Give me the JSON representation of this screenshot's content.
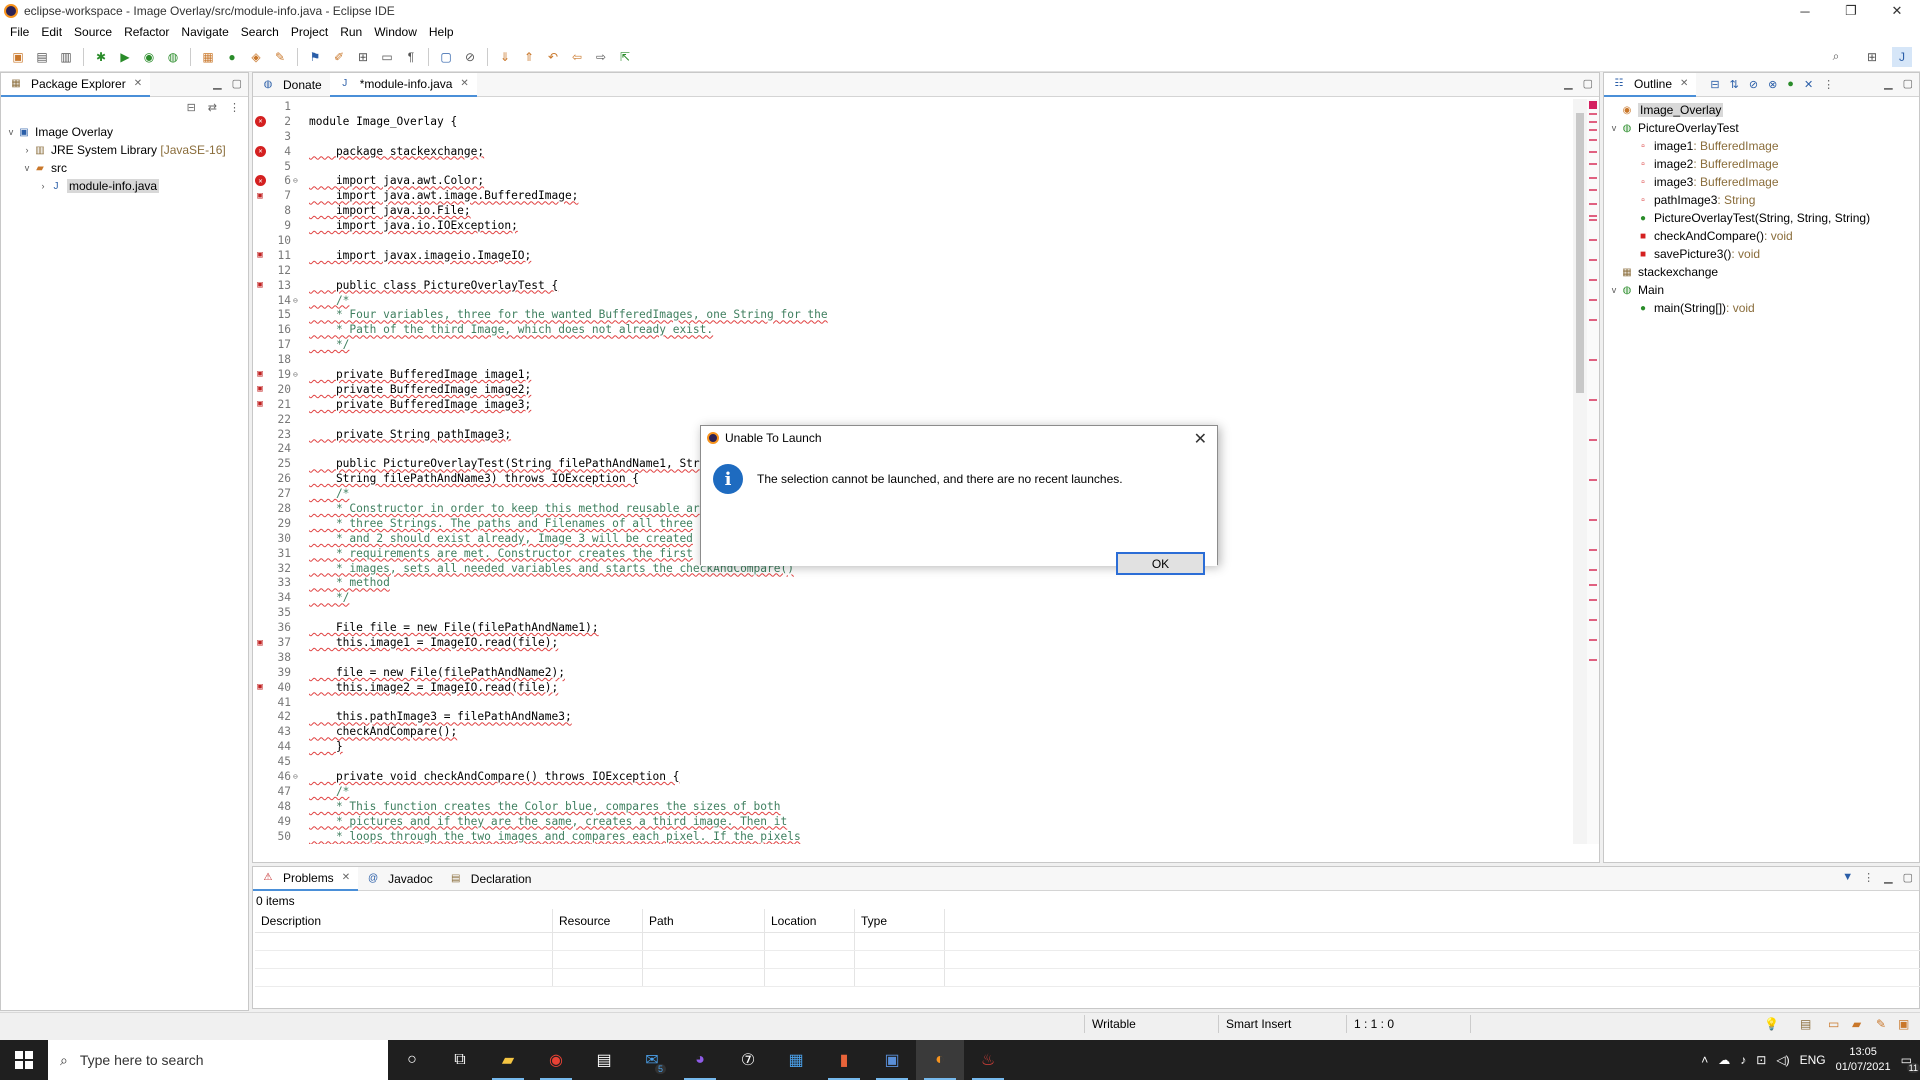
{
  "window": {
    "title": "eclipse-workspace - Image Overlay/src/module-info.java - Eclipse IDE"
  },
  "menu": [
    "File",
    "Edit",
    "Source",
    "Refactor",
    "Navigate",
    "Search",
    "Project",
    "Run",
    "Window",
    "Help"
  ],
  "package_explorer": {
    "tab": "Package Explorer",
    "items": [
      {
        "label": "Image Overlay",
        "suffix": ""
      },
      {
        "label": "JRE System Library",
        "suffix": "[JavaSE-16]"
      },
      {
        "label": "src",
        "suffix": ""
      },
      {
        "label": "module-info.java",
        "suffix": ""
      }
    ]
  },
  "editor": {
    "tabs": [
      "Donate",
      "*module-info.java"
    ],
    "lines": [
      {
        "n": "1",
        "t": "",
        "cls": "cur",
        "m": ""
      },
      {
        "n": "2",
        "t": "module Image_Overlay {",
        "cls": "",
        "m": "err"
      },
      {
        "n": "3",
        "t": "",
        "cls": "",
        "m": ""
      },
      {
        "n": "4",
        "t": "    package stackexchange;",
        "cls": "sq",
        "m": "err"
      },
      {
        "n": "5",
        "t": "",
        "cls": "",
        "m": ""
      },
      {
        "n": "6",
        "t": "    import java.awt.Color;",
        "cls": "sq",
        "m": "err",
        "f": "⊖"
      },
      {
        "n": "7",
        "t": "    import java.awt.image.BufferedImage;",
        "cls": "sq",
        "m": "warn"
      },
      {
        "n": "8",
        "t": "    import java.io.File;",
        "cls": "sq",
        "m": ""
      },
      {
        "n": "9",
        "t": "    import java.io.IOException;",
        "cls": "sq",
        "m": ""
      },
      {
        "n": "10",
        "t": "",
        "cls": "",
        "m": ""
      },
      {
        "n": "11",
        "t": "    import javax.imageio.ImageIO;",
        "cls": "sq",
        "m": "warn"
      },
      {
        "n": "12",
        "t": "",
        "cls": "",
        "m": ""
      },
      {
        "n": "13",
        "t": "    public class PictureOverlayTest {",
        "cls": "sq",
        "m": "warn"
      },
      {
        "n": "14",
        "t": "    /*",
        "cls": "sq cm",
        "m": "",
        "f": "⊖"
      },
      {
        "n": "15",
        "t": "    * Four variables, three for the wanted BufferedImages, one String for the",
        "cls": "sq cm",
        "m": ""
      },
      {
        "n": "16",
        "t": "    * Path of the third Image, which does not already exist.",
        "cls": "sq cm",
        "m": ""
      },
      {
        "n": "17",
        "t": "    */",
        "cls": "sq cm",
        "m": ""
      },
      {
        "n": "18",
        "t": "",
        "cls": "",
        "m": ""
      },
      {
        "n": "19",
        "t": "    private BufferedImage image1;",
        "cls": "sq",
        "m": "warn",
        "f": "⊖"
      },
      {
        "n": "20",
        "t": "    private BufferedImage image2;",
        "cls": "sq",
        "m": "warn"
      },
      {
        "n": "21",
        "t": "    private BufferedImage image3;",
        "cls": "sq",
        "m": "warn"
      },
      {
        "n": "22",
        "t": "",
        "cls": "",
        "m": ""
      },
      {
        "n": "23",
        "t": "    private String pathImage3;",
        "cls": "sq",
        "m": ""
      },
      {
        "n": "24",
        "t": "",
        "cls": "",
        "m": ""
      },
      {
        "n": "25",
        "t": "    public PictureOverlayTest(String filePathAndName1, Str",
        "cls": "sq",
        "m": ""
      },
      {
        "n": "26",
        "t": "    String filePathAndName3) throws IOException {",
        "cls": "sq",
        "m": ""
      },
      {
        "n": "27",
        "t": "    /*",
        "cls": "sq cm",
        "m": ""
      },
      {
        "n": "28",
        "t": "    * Constructor in order to keep this method reusable ar",
        "cls": "sq cm",
        "m": ""
      },
      {
        "n": "29",
        "t": "    * three Strings. The paths and Filenames of all three",
        "cls": "sq cm",
        "m": ""
      },
      {
        "n": "30",
        "t": "    * and 2 should exist already, Image 3 will be created",
        "cls": "sq cm",
        "m": ""
      },
      {
        "n": "31",
        "t": "    * requirements are met. Constructor creates the first",
        "cls": "sq cm",
        "m": ""
      },
      {
        "n": "32",
        "t": "    * images, sets all needed variables and starts the checkAndCompare()",
        "cls": "sq cm",
        "m": ""
      },
      {
        "n": "33",
        "t": "    * method",
        "cls": "sq cm",
        "m": ""
      },
      {
        "n": "34",
        "t": "    */",
        "cls": "sq cm",
        "m": ""
      },
      {
        "n": "35",
        "t": "",
        "cls": "",
        "m": ""
      },
      {
        "n": "36",
        "t": "    File file = new File(filePathAndName1);",
        "cls": "sq",
        "m": ""
      },
      {
        "n": "37",
        "t": "    this.image1 = ImageIO.read(file);",
        "cls": "sq",
        "m": "warn"
      },
      {
        "n": "38",
        "t": "",
        "cls": "",
        "m": ""
      },
      {
        "n": "39",
        "t": "    file = new File(filePathAndName2);",
        "cls": "sq",
        "m": ""
      },
      {
        "n": "40",
        "t": "    this.image2 = ImageIO.read(file);",
        "cls": "sq",
        "m": "warn"
      },
      {
        "n": "41",
        "t": "",
        "cls": "",
        "m": ""
      },
      {
        "n": "42",
        "t": "    this.pathImage3 = filePathAndName3;",
        "cls": "sq",
        "m": ""
      },
      {
        "n": "43",
        "t": "    checkAndCompare();",
        "cls": "sq",
        "m": ""
      },
      {
        "n": "44",
        "t": "    }",
        "cls": "sq",
        "m": ""
      },
      {
        "n": "45",
        "t": "",
        "cls": "",
        "m": ""
      },
      {
        "n": "46",
        "t": "    private void checkAndCompare() throws IOException {",
        "cls": "sq",
        "m": "",
        "f": "⊖"
      },
      {
        "n": "47",
        "t": "    /*",
        "cls": "sq cm",
        "m": ""
      },
      {
        "n": "48",
        "t": "    * This function creates the Color blue, compares the sizes of both",
        "cls": "sq cm",
        "m": ""
      },
      {
        "n": "49",
        "t": "    * pictures and if they are the same, creates a third image. Then it",
        "cls": "sq cm",
        "m": ""
      },
      {
        "n": "50",
        "t": "    * loops through the two images and compares each pixel. If the pixels",
        "cls": "sq cm",
        "m": ""
      }
    ]
  },
  "outline": {
    "tab": "Outline",
    "items": [
      {
        "label": "Image_Overlay",
        "type": "",
        "indent": 0,
        "icon": "module",
        "sel": true
      },
      {
        "label": "PictureOverlayTest",
        "type": "",
        "indent": 0,
        "icon": "class",
        "tw": "v"
      },
      {
        "label": "image1",
        "type": " : BufferedImage",
        "indent": 2,
        "icon": "field"
      },
      {
        "label": "image2",
        "type": " : BufferedImage",
        "indent": 2,
        "icon": "field"
      },
      {
        "label": "image3",
        "type": " : BufferedImage",
        "indent": 2,
        "icon": "field"
      },
      {
        "label": "pathImage3",
        "type": " : String",
        "indent": 2,
        "icon": "field"
      },
      {
        "label": "PictureOverlayTest(String, String, String)",
        "type": "",
        "indent": 2,
        "icon": "ctor"
      },
      {
        "label": "checkAndCompare()",
        "type": " : void",
        "indent": 2,
        "icon": "method"
      },
      {
        "label": "savePicture3()",
        "type": " : void",
        "indent": 2,
        "icon": "method"
      },
      {
        "label": "stackexchange",
        "type": "",
        "indent": 0,
        "icon": "package"
      },
      {
        "label": "Main",
        "type": "",
        "indent": 0,
        "icon": "class",
        "tw": "v"
      },
      {
        "label": "main(String[])",
        "type": " : void",
        "indent": 2,
        "icon": "pubmethod"
      }
    ]
  },
  "bottom": {
    "tabs": [
      "Problems",
      "Javadoc",
      "Declaration"
    ],
    "count": "0 items",
    "columns": [
      "Description",
      "Resource",
      "Path",
      "Location",
      "Type"
    ]
  },
  "status": {
    "writable": "Writable",
    "insert": "Smart Insert",
    "position": "1 : 1 : 0"
  },
  "dialog": {
    "title": "Unable To Launch",
    "message": "The selection cannot be launched, and there are no recent launches.",
    "ok": "OK"
  },
  "taskbar": {
    "search_placeholder": "Type here to search",
    "lang": "ENG",
    "time": "13:05",
    "date": "01/07/2021",
    "notif_count": "11",
    "mail_badge": "5"
  }
}
